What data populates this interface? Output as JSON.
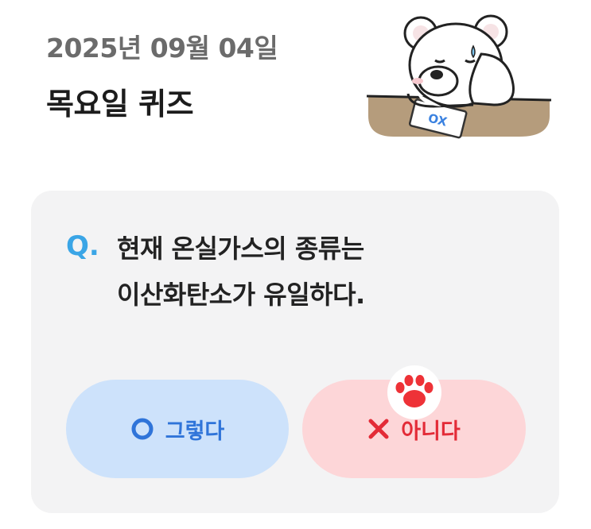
{
  "header": {
    "date": "2025년 09월 04일",
    "title": "목요일 퀴즈"
  },
  "mascot": {
    "icon": "bear-mascot-icon",
    "paper_label": "OX"
  },
  "quiz": {
    "marker": "Q.",
    "question_lines": [
      "현재 온실가스의 종류는",
      "이산화탄소가 유일하다."
    ],
    "answers": [
      {
        "icon": "circle-o-icon",
        "label": "그렇다",
        "color": "#2f74d9",
        "background": "#cde2fb"
      },
      {
        "icon": "x-mark-icon",
        "label": "아니다",
        "color": "#e32b37",
        "background": "#fdd6d8"
      }
    ],
    "selection_badge_icon": "paw-icon"
  },
  "colors": {
    "accent_blue": "#3aa5e6",
    "card_background": "#f3f3f4"
  }
}
